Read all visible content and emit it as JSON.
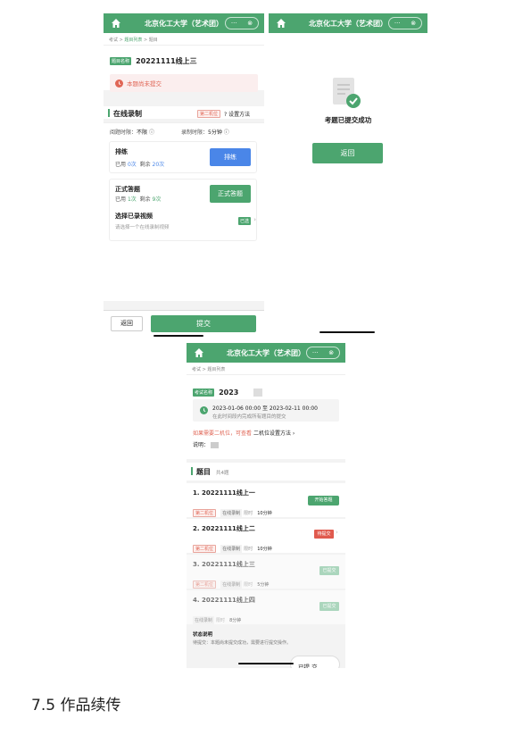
{
  "header": {
    "title": "北京化工大学（艺术团）"
  },
  "screen1": {
    "breadcrumb": [
      "考试",
      "题目列表",
      "题目"
    ],
    "tag": "题目名称",
    "name": "20221111线上三",
    "alert": "本题尚未提交",
    "section_title": "在线录制",
    "mode_tag": "第二机位",
    "setup_link": "设置方法",
    "read_label": "阅题时限：",
    "read_value": "不限",
    "rec_label": "录制时限：",
    "rec_value": "5分钟",
    "practice": {
      "title": "排练",
      "used_label": "已用",
      "used": "0次",
      "left_label": "剩余",
      "left": "20次",
      "button": "排练"
    },
    "formal": {
      "title": "正式答题",
      "used_label": "已用",
      "used": "1次",
      "left_label": "剩余",
      "left": "9次",
      "button": "正式答题"
    },
    "select": {
      "title": "选择已录视频",
      "hint": "请选择一个在线录制视频",
      "badge": "已选"
    },
    "back_button": "返回",
    "submit_button": "提交"
  },
  "screen2": {
    "message": "考题已提交成功",
    "back_button": "返回"
  },
  "screen3": {
    "breadcrumb": [
      "考试",
      "题目列表"
    ],
    "tag": "考试名称",
    "name": "2023",
    "time_range": "2023-01-06 00:00 至 2023-02-11 00:00",
    "time_hint": "在此时间段内完成所有题目的提交",
    "camera_note": "如果需要二机位，可查看",
    "camera_link": "二机位设置方法",
    "desc_label": "说明：",
    "list_title": "题目",
    "list_count": "共4题",
    "items": [
      {
        "title": "1. 20221111线上一",
        "tags": [
          "第二机位",
          "在线录制",
          "限时",
          "10分钟"
        ],
        "action": "开始答题"
      },
      {
        "title": "2. 20221111线上二",
        "tags": [
          "第二机位",
          "在线录制",
          "限时",
          "10分钟"
        ],
        "action": "待提交"
      },
      {
        "title": "3. 20221111线上三",
        "tags": [
          "第二机位",
          "在线录制",
          "限时",
          "5分钟"
        ],
        "action": "已提交"
      },
      {
        "title": "4. 20221111线上四",
        "tags": [
          "在线录制",
          "限时",
          "8分钟"
        ],
        "action": "已提交"
      }
    ],
    "status_title": "状态说明",
    "status_text": "待提交：本题尚未提交成功，需要进行提交操作。",
    "bottom_btn": "提 交",
    "bottom_btn_prefix": "已"
  },
  "caption": "7.5 作品续传",
  "colors": {
    "primary": "#4ca56f",
    "blue": "#4a86e8",
    "red": "#e06656"
  }
}
